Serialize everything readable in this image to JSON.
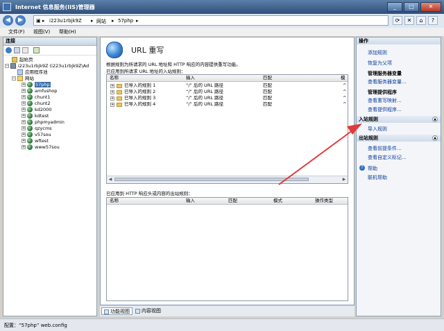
{
  "window": {
    "title": "Internet 信息服务(IIS)管理器"
  },
  "address": {
    "crumbs": [
      "i223u1rbjk9Z",
      "网站",
      "57php"
    ]
  },
  "menu": {
    "items": [
      "文件(F)",
      "视图(V)",
      "帮助(H)"
    ]
  },
  "connections": {
    "header": "连接",
    "tree": [
      {
        "label": "起始页",
        "icon": "start-page-icon"
      },
      {
        "label": "i223u1rbjk9Z (i223u1rbjk9Z\\Ad",
        "icon": "server-icon"
      },
      {
        "label": "应用程序池",
        "icon": "app-pool-icon"
      },
      {
        "label": "网站",
        "icon": "sites-folder-icon"
      },
      {
        "label": "57php",
        "icon": "globe-icon"
      },
      {
        "label": "amfushop",
        "icon": "globe-icon"
      },
      {
        "label": "chunt1",
        "icon": "globe-icon"
      },
      {
        "label": "chunt2",
        "icon": "globe-icon"
      },
      {
        "label": "kd2000",
        "icon": "globe-icon"
      },
      {
        "label": "kdtest",
        "icon": "globe-icon"
      },
      {
        "label": "phpmyadmin",
        "icon": "globe-icon"
      },
      {
        "label": "qzycms",
        "icon": "globe-icon"
      },
      {
        "label": "v57sou",
        "icon": "globe-icon"
      },
      {
        "label": "wftest",
        "icon": "globe-icon"
      },
      {
        "label": "www57sou",
        "icon": "globe-icon"
      }
    ]
  },
  "feature": {
    "title": "URL 重写",
    "description": "根据规则为所请求的 URL 地址和 HTTP 响应的内容提供重写功能。",
    "inbound_label": "已应用到所请求 URL 地址的入站规则：",
    "inbound_headers": [
      "名称",
      "输入",
      "匹配",
      "模"
    ],
    "inbound_rules": [
      {
        "name": "已导入的规则 1",
        "input": "“/” 后的 URL 路径",
        "match": "匹配",
        "extra": "^"
      },
      {
        "name": "已导入的规则 2",
        "input": "“/” 后的 URL 路径",
        "match": "匹配",
        "extra": "^"
      },
      {
        "name": "已导入的规则 3",
        "input": "“/” 后的 URL 路径",
        "match": "匹配",
        "extra": "^"
      },
      {
        "name": "已导入的规则 4",
        "input": "“/” 后的 URL 路径",
        "match": "匹配",
        "extra": "^"
      }
    ],
    "outbound_label": "已应用到 HTTP 响应头或内容的出站规则：",
    "outbound_headers": [
      "名称",
      "输入",
      "匹配",
      "模式",
      "操作类型"
    ]
  },
  "view_tabs": [
    "功能视图",
    "内容视图"
  ],
  "actions": {
    "header": "操作",
    "top_items": [
      "添加规则",
      "恢复为父项"
    ],
    "server_vars_title": "管理服务器变量",
    "server_vars_link": "查看服务器变量...",
    "providers_title": "管理提供程序",
    "providers_links": [
      "查看重写映射...",
      "查看提供程序..."
    ],
    "inbound_group": "入站规则",
    "inbound_items": [
      "导入规则"
    ],
    "outbound_group": "出站规则",
    "outbound_items": [
      "查看前提条件...",
      "查看自定义标记..."
    ],
    "help_items": [
      "帮助",
      "联机帮助"
    ]
  },
  "status": {
    "text": "配置：“57php” web.config"
  },
  "accent_color": "#e03a3a"
}
